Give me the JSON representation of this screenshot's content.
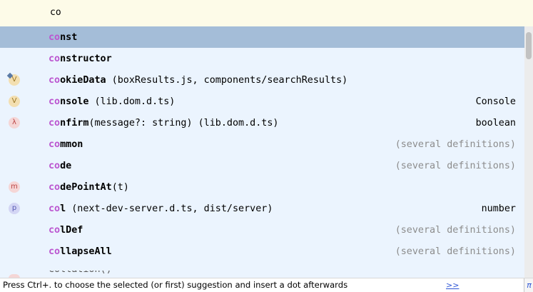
{
  "editor": {
    "typed_text": "co"
  },
  "completion": {
    "items": [
      {
        "prefix": "co",
        "rest": "nst",
        "detail": "",
        "type": "",
        "icon": null,
        "selected": true
      },
      {
        "prefix": "co",
        "rest": "nstructor",
        "detail": "",
        "type": "",
        "icon": null
      },
      {
        "prefix": "co",
        "rest": "okieData",
        "detail": " (boxResults.js, components/searchResults)",
        "type": "",
        "icon": "variable-icon",
        "icon_letter": "V"
      },
      {
        "prefix": "co",
        "rest": "nsole",
        "detail": " (lib.dom.d.ts)",
        "type": "Console",
        "icon": "variable-icon",
        "icon_letter": "V"
      },
      {
        "prefix": "co",
        "rest": "nfirm",
        "detail": "(message?: string) (lib.dom.d.ts)",
        "type": "boolean",
        "icon": "function-icon",
        "icon_letter": "λ"
      },
      {
        "prefix": "co",
        "rest": "mmon",
        "detail": "",
        "type": "(several definitions)",
        "icon": null,
        "dim_type": true
      },
      {
        "prefix": "co",
        "rest": "de",
        "detail": "",
        "type": "(several definitions)",
        "icon": null,
        "dim_type": true
      },
      {
        "prefix": "co",
        "rest": "dePointAt",
        "detail": "(t)",
        "type": "",
        "icon": "method-icon",
        "icon_letter": "m"
      },
      {
        "prefix": "co",
        "rest": "l",
        "detail": " (next-dev-server.d.ts, dist/server)",
        "type": "number",
        "icon": "property-icon",
        "icon_letter": "p"
      },
      {
        "prefix": "co",
        "rest": "lDef",
        "detail": "",
        "type": "(several definitions)",
        "icon": null,
        "dim_type": true
      },
      {
        "prefix": "co",
        "rest": "llapseAll",
        "detail": "",
        "type": "(several definitions)",
        "icon": null,
        "dim_type": true
      }
    ],
    "partial_item": "collation()"
  },
  "status": {
    "hint": "Press Ctrl+. to choose the selected (or first) suggestion and insert a dot afterwards",
    "more_link": ">>",
    "pi_label": "π"
  },
  "colors": {
    "match": "#bb56d0",
    "selected_bg": "#a4bdd8",
    "popup_bg": "#ebf4fe",
    "editor_bg": "#fdfbe8",
    "link": "#2d55d6"
  }
}
